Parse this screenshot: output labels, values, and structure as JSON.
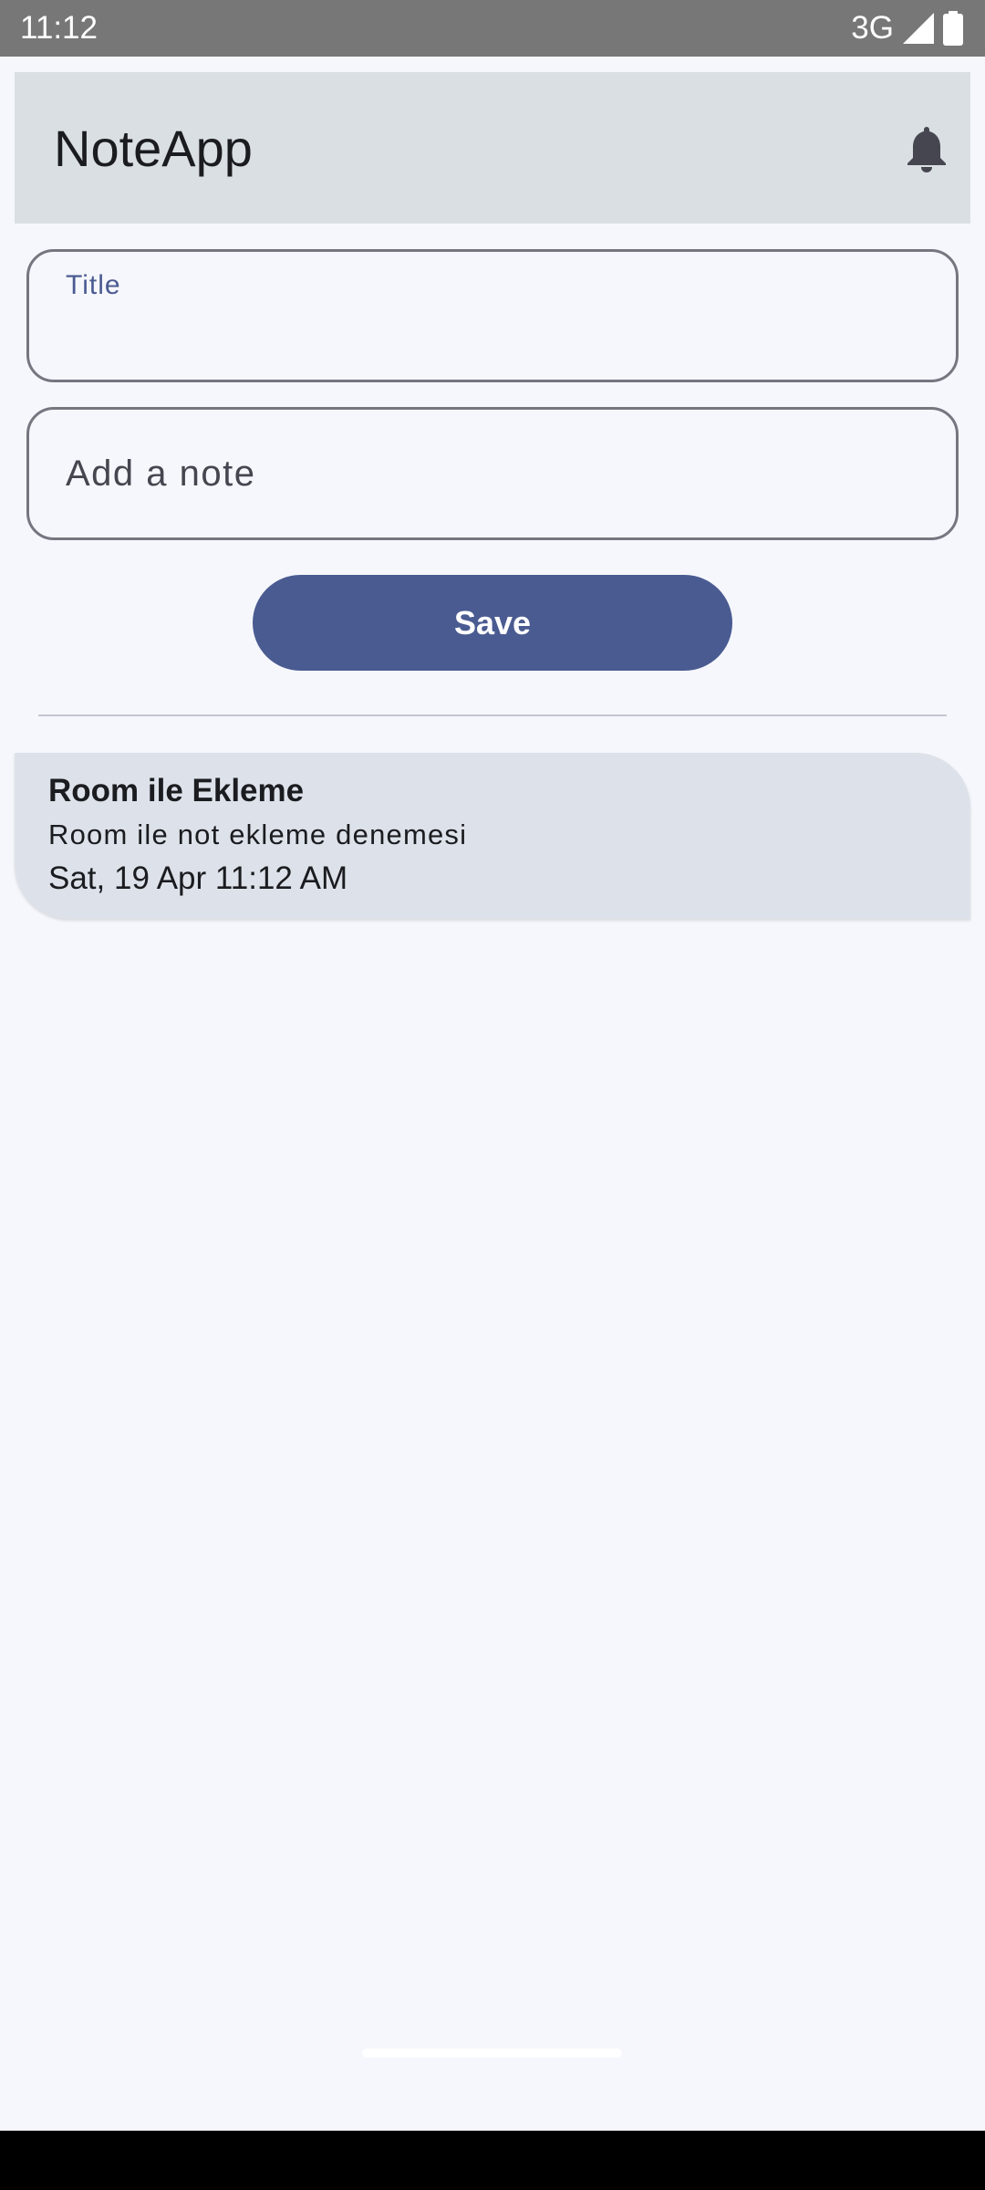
{
  "status_bar": {
    "time": "11:12",
    "network": "3G",
    "icons": [
      "signal-icon",
      "battery-icon"
    ]
  },
  "app_bar": {
    "title": "NoteApp",
    "action_icon": "bell-icon"
  },
  "form": {
    "title_label": "Title",
    "title_value": "",
    "note_placeholder": "Add a note",
    "save_label": "Save"
  },
  "notes": [
    {
      "title": "Room ile Ekleme",
      "body": "Room ile not ekleme denemesi",
      "date": "Sat, 19 Apr 11:12 AM"
    }
  ],
  "colors": {
    "primary": "#4a5b91",
    "app_bar_bg": "#dadfe3",
    "card_bg": "#dde2ea",
    "background": "#f6f7fc"
  }
}
